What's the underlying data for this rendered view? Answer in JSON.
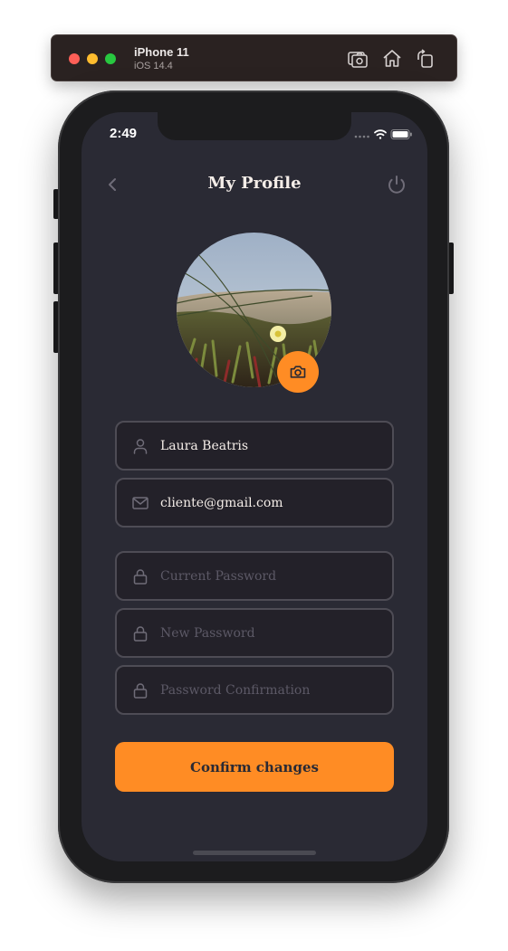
{
  "simulator": {
    "device_name": "iPhone 11",
    "os_version": "iOS 14.4",
    "buttons": [
      "screenshot-icon",
      "home-icon",
      "rotate-icon"
    ]
  },
  "status_bar": {
    "time": "2:49",
    "icons": [
      "cellular-icon",
      "wifi-icon",
      "battery-icon"
    ]
  },
  "header": {
    "title": "My Profile",
    "back_icon": "chevron-left-icon",
    "power_icon": "power-icon"
  },
  "avatar": {
    "camera_icon": "camera-icon"
  },
  "form": {
    "name": {
      "value": "Laura Beatris",
      "icon": "user-icon"
    },
    "email": {
      "value": "cliente@gmail.com",
      "icon": "mail-icon"
    },
    "current_password": {
      "placeholder": "Current Password",
      "icon": "lock-icon"
    },
    "new_password": {
      "placeholder": "New Password",
      "icon": "lock-icon"
    },
    "password_confirmation": {
      "placeholder": "Password Confirmation",
      "icon": "lock-icon"
    }
  },
  "confirm_button": {
    "label": "Confirm changes"
  },
  "colors": {
    "accent": "#ff8c24",
    "background": "#2a2a34",
    "input_background": "#232129",
    "input_border": "#4e4c55",
    "placeholder": "#5c5966",
    "text": "#f4ede8"
  }
}
